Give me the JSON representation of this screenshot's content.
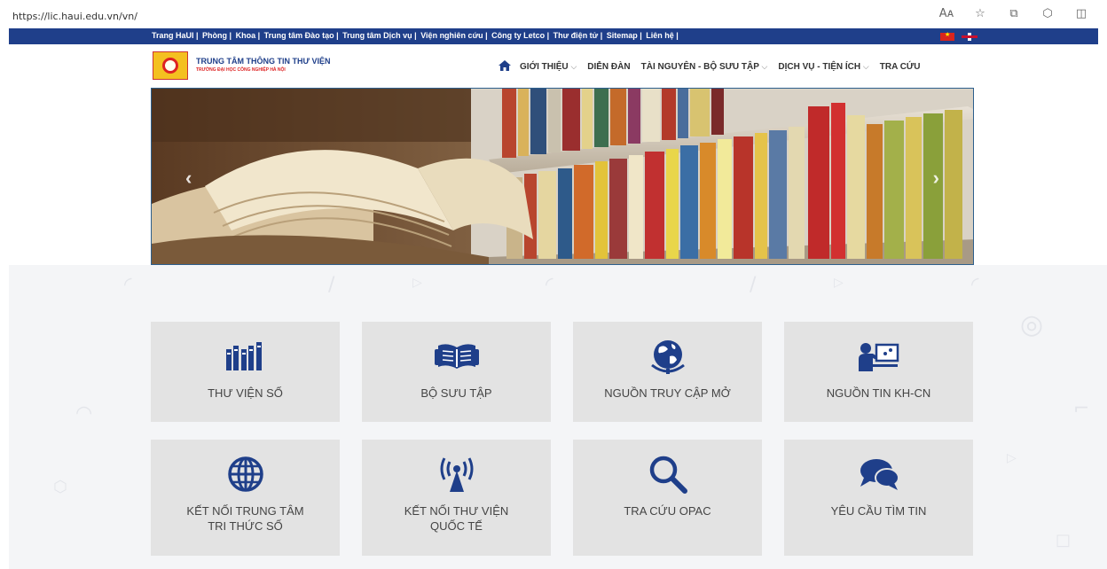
{
  "browser": {
    "url": "https://lic.haui.edu.vn/vn/",
    "icons": [
      "read-aloud-icon",
      "favorite-star-icon",
      "screenshot-icon",
      "extensions-icon",
      "split-screen-icon"
    ],
    "icon_glyphs": [
      "Aᴀ",
      "☆",
      "⧉",
      "⬡",
      "◫"
    ]
  },
  "top_nav": {
    "links": [
      "Trang HaUI |",
      "Phòng |",
      "Khoa |",
      "Trung tâm Đào tạo |",
      "Trung tâm Dịch vụ |",
      "Viện nghiên cứu |",
      "Công ty Letco |",
      "Thư điện tử |",
      "Sitemap |",
      "Liên hệ |"
    ]
  },
  "header": {
    "logo_title": "TRUNG TÂM THÔNG TIN THƯ VIỆN",
    "logo_subtitle": "TRƯỜNG ĐẠI HỌC CÔNG NGHIỆP HÀ NỘI",
    "nav": [
      {
        "label": "GIỚI THIỆU",
        "dropdown": true
      },
      {
        "label": "DIỄN ĐÀN",
        "dropdown": false
      },
      {
        "label": "TÀI NGUYÊN - BỘ SƯU TẬP",
        "dropdown": true
      },
      {
        "label": "DỊCH VỤ - TIỆN ÍCH",
        "dropdown": true
      },
      {
        "label": "TRA CỨU",
        "dropdown": false
      }
    ]
  },
  "tiles": [
    {
      "label": "THƯ VIỆN SỐ",
      "icon": "bookshelf-icon"
    },
    {
      "label": "BỘ SƯU TẬP",
      "icon": "open-book-icon"
    },
    {
      "label": "NGUỒN TRUY CẬP MỞ",
      "icon": "globe-icon"
    },
    {
      "label": "NGUỒN TIN KH-CN",
      "icon": "presenter-icon"
    },
    {
      "label": "KẾT NỐI TRUNG TÂM\nTRI THỨC SỐ",
      "icon": "world-grid-icon"
    },
    {
      "label": "KẾT NỐI THƯ VIỆN\nQUỐC TẾ",
      "icon": "antenna-icon"
    },
    {
      "label": "TRA CỨU OPAC",
      "icon": "search-icon"
    },
    {
      "label": "YÊU CẦU TÌM TIN",
      "icon": "chat-bubbles-icon"
    }
  ],
  "colors": {
    "brand_blue": "#1f3f8a",
    "icon_blue": "#1f3f8a",
    "tile_bg": "#e3e3e3"
  }
}
